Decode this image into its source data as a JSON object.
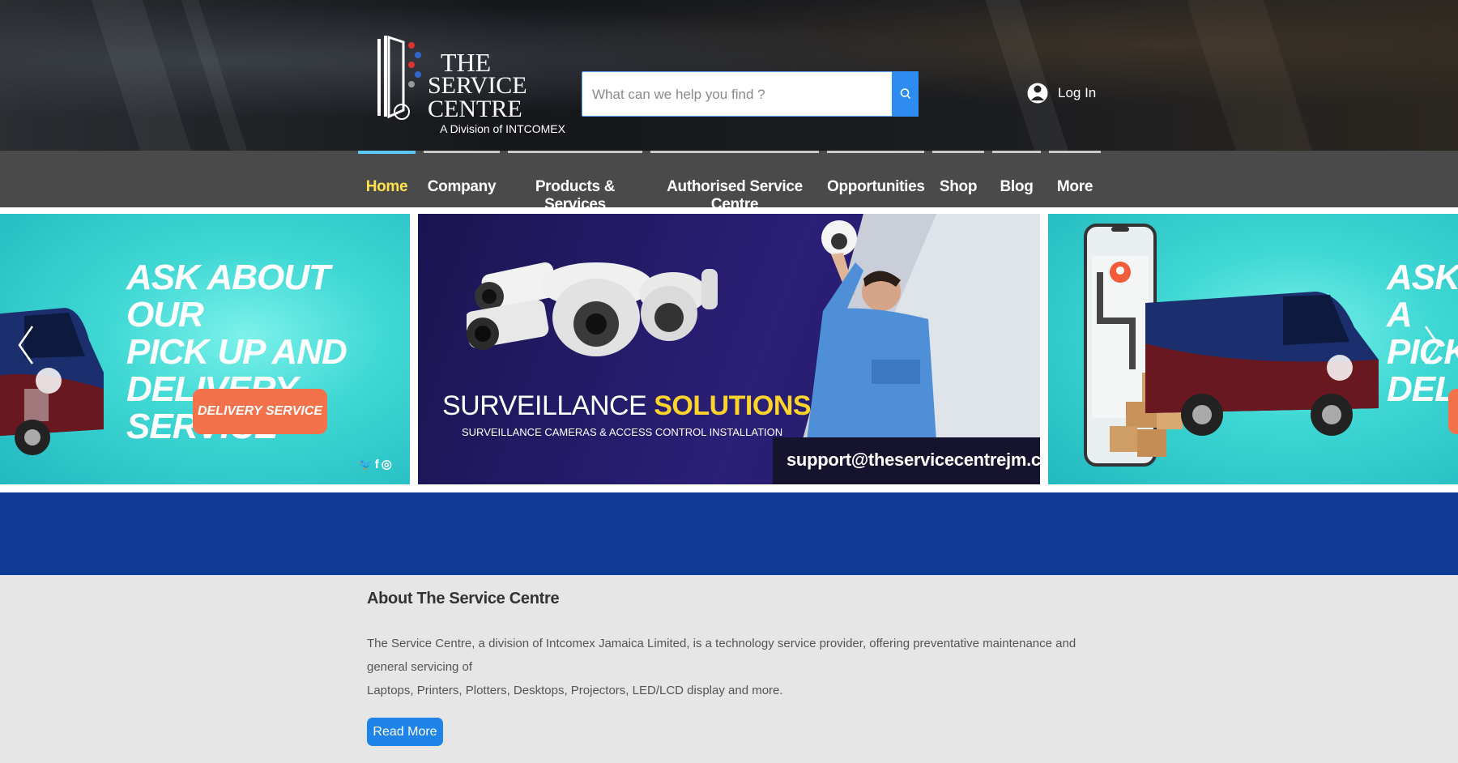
{
  "header": {
    "logo": {
      "line1": "THE",
      "line2": "SERVICE CENTRE",
      "line3": "A Division of INTCOMEX"
    },
    "search": {
      "placeholder": "What can we help you find ?",
      "icon": "search-icon"
    },
    "login": {
      "label": "Log In",
      "icon": "user-avatar-icon"
    }
  },
  "nav": {
    "items": [
      {
        "label": "Home",
        "active": true
      },
      {
        "label": "Company",
        "active": false
      },
      {
        "label": "Products & Services",
        "active": false
      },
      {
        "label": "Authorised Service Centre",
        "active": false
      },
      {
        "label": "Opportunities",
        "active": false
      },
      {
        "label": "Shop",
        "active": false
      },
      {
        "label": "Blog",
        "active": false
      },
      {
        "label": "More",
        "active": false
      }
    ]
  },
  "slider": {
    "left": {
      "headline": [
        "ASK ABOUT OUR",
        "PICK UP AND",
        "DELIVERY SERVICE"
      ],
      "button": "DELIVERY SERVICE"
    },
    "center": {
      "title_a": "SURVEILLANCE",
      "title_b": "SOLUTIONS",
      "subtitle": "SURVEILLANCE CAMERAS & ACCESS CONTROL INSTALLATION",
      "email": "support@theservicecentrejm.com"
    },
    "right": {
      "headline": [
        "ASK A",
        "PICK",
        "DELI"
      ]
    },
    "prev_icon": "chevron-left-icon",
    "next_icon": "chevron-right-icon"
  },
  "about": {
    "title": "About The Service Centre",
    "body_line1": "The Service Centre, a division of Intcomex Jamaica Limited, is a technology service provider, offering preventative maintenance and general servicing of",
    "body_line2": "Laptops, Printers, Plotters, Desktops, Projectors, LED/LCD display and more.",
    "button": "Read More"
  },
  "colors": {
    "nav_bg": "#4a4a4a",
    "active_nav": "#ffe14d",
    "band": "#0f3b96",
    "accent_blue": "#1e84ea",
    "promo_orange": "#f4724b"
  }
}
